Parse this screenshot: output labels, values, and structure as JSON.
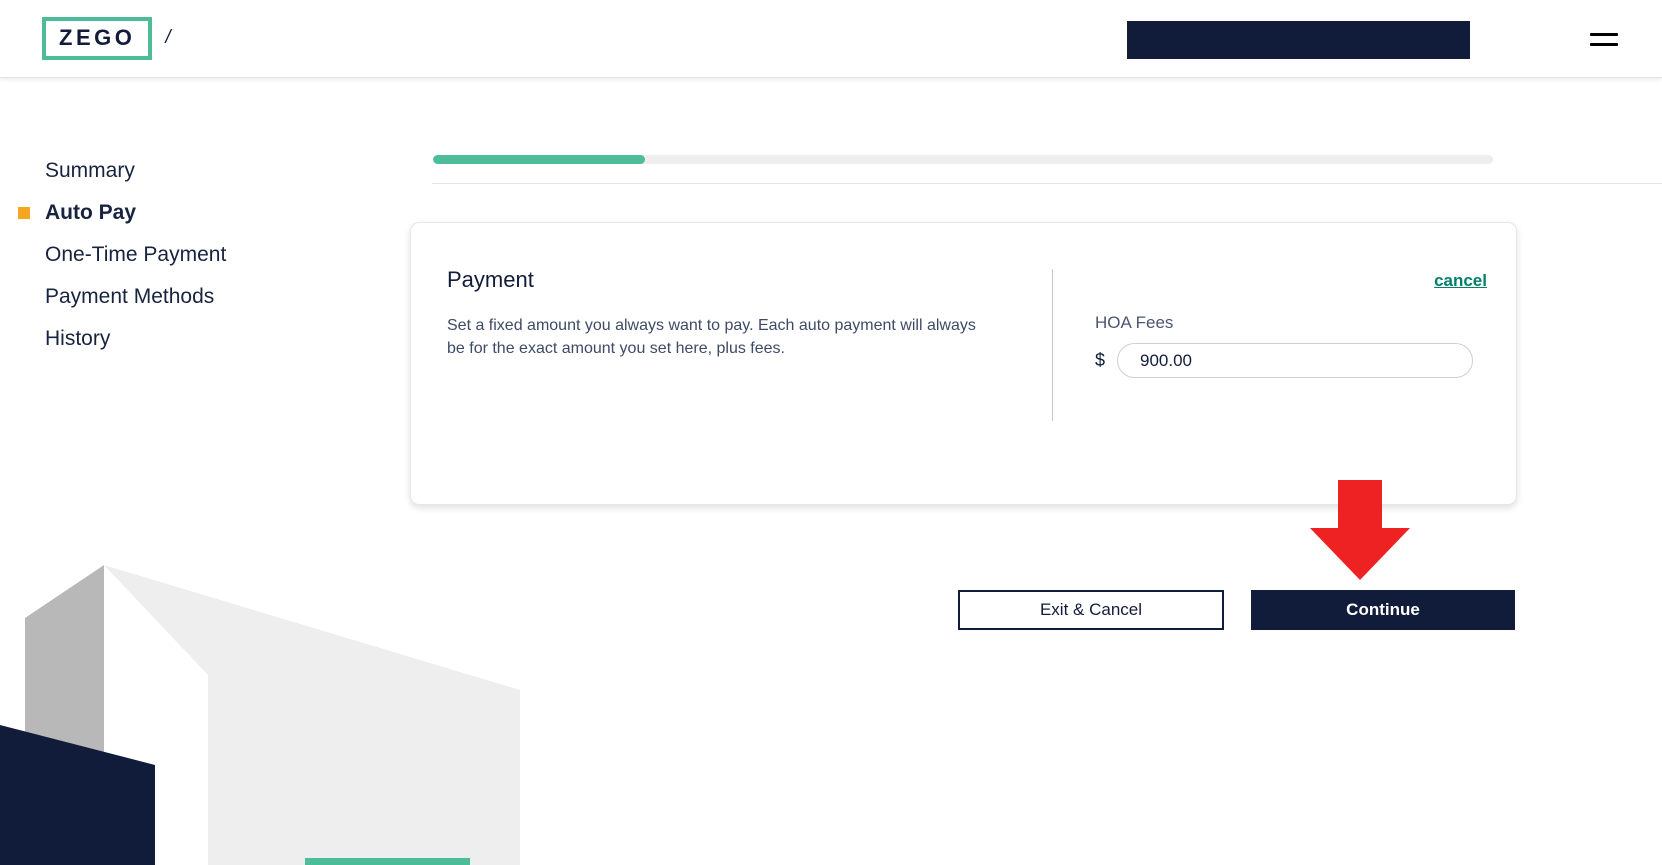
{
  "header": {
    "logo_text": "ZEGO",
    "separator": "/",
    "account_bar_label": "",
    "menu_icon": "hamburger-menu-icon"
  },
  "sidebar": {
    "items": [
      {
        "label": "Summary",
        "active": false
      },
      {
        "label": "Auto Pay",
        "active": true
      },
      {
        "label": "One-Time Payment",
        "active": false
      },
      {
        "label": "Payment Methods",
        "active": false
      },
      {
        "label": "History",
        "active": false
      }
    ]
  },
  "progress": {
    "percent": 20,
    "fill_color": "#4dbd99",
    "track_color": "#eeeeee"
  },
  "card": {
    "heading": "Payment",
    "description": "Set a fixed amount you always want to pay. Each auto payment will always be for the exact amount you set here, plus fees.",
    "cancel_label": "cancel",
    "amount_label": "HOA Fees",
    "currency_symbol": "$",
    "amount_value": "900.00",
    "amount_placeholder": "0.00"
  },
  "footer": {
    "exit_cancel_label": "Exit & Cancel",
    "continue_label": "Continue"
  },
  "annotation": {
    "arrow_icon": "down-arrow-icon",
    "arrow_color": "#ee2222"
  },
  "colors": {
    "brand_navy": "#111c3a",
    "brand_green": "#4dbd99",
    "accent_orange": "#f5a623",
    "link_teal": "#00806b"
  }
}
